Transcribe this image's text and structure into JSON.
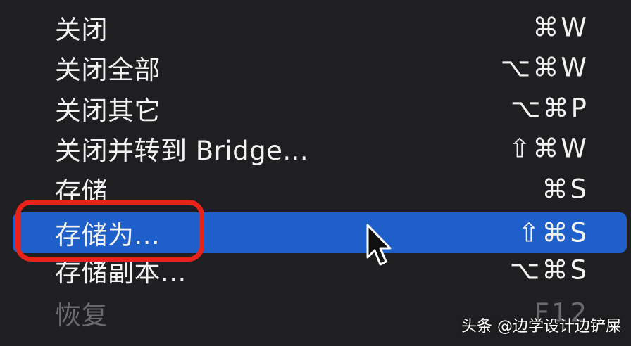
{
  "menu": {
    "items": [
      {
        "label": "关闭",
        "shortcut": "⌘W",
        "state": "normal"
      },
      {
        "label": "关闭全部",
        "shortcut": "⌥⌘W",
        "state": "normal"
      },
      {
        "label": "关闭其它",
        "shortcut": "⌥⌘P",
        "state": "normal"
      },
      {
        "label": "关闭并转到 Bridge...",
        "shortcut": "⇧⌘W",
        "state": "normal"
      },
      {
        "label": "存储",
        "shortcut": "⌘S",
        "state": "normal"
      },
      {
        "label": "存储为...",
        "shortcut": "⇧⌘S",
        "state": "selected"
      },
      {
        "label": "存储副本...",
        "shortcut": "⌥⌘S",
        "state": "normal"
      },
      {
        "label": "恢复",
        "shortcut": "F12",
        "state": "disabled"
      }
    ]
  },
  "colors": {
    "menu_background": "#1f1f21",
    "selected_background": "#1f5fc9",
    "highlight_ring": "#e8231c",
    "text": "#f2f2f2",
    "disabled_text": "#6b6b6e"
  },
  "icons": {
    "cursor": "arrow-pointer-icon"
  },
  "watermark": {
    "text": "头条 @边学设计边铲屎"
  }
}
